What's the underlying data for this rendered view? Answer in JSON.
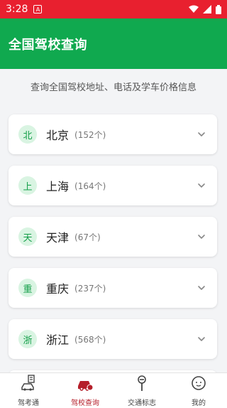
{
  "status": {
    "time": "3:28"
  },
  "header": {
    "title": "全国驾校查询"
  },
  "subtitle": "查询全国驾校地址、电话及学车价格信息",
  "regions": [
    {
      "badge": "北",
      "name": "北京",
      "count": "(152个)"
    },
    {
      "badge": "上",
      "name": "上海",
      "count": "(164个)"
    },
    {
      "badge": "天",
      "name": "天津",
      "count": "(67个)"
    },
    {
      "badge": "重",
      "name": "重庆",
      "count": "(237个)"
    },
    {
      "badge": "浙",
      "name": "浙江",
      "count": "(568个)"
    }
  ],
  "nav": [
    {
      "label": "驾考通",
      "icon": "driving-test-icon",
      "active": false
    },
    {
      "label": "驾校查询",
      "icon": "car-icon",
      "active": true
    },
    {
      "label": "交通标志",
      "icon": "traffic-sign-icon",
      "active": false
    },
    {
      "label": "我的",
      "icon": "profile-icon",
      "active": false
    }
  ],
  "colors": {
    "status_bar": "#e8202f",
    "header": "#10a94f",
    "badge_bg": "#d9f4e2",
    "badge_text": "#139e48",
    "nav_active": "#b51f2a"
  }
}
